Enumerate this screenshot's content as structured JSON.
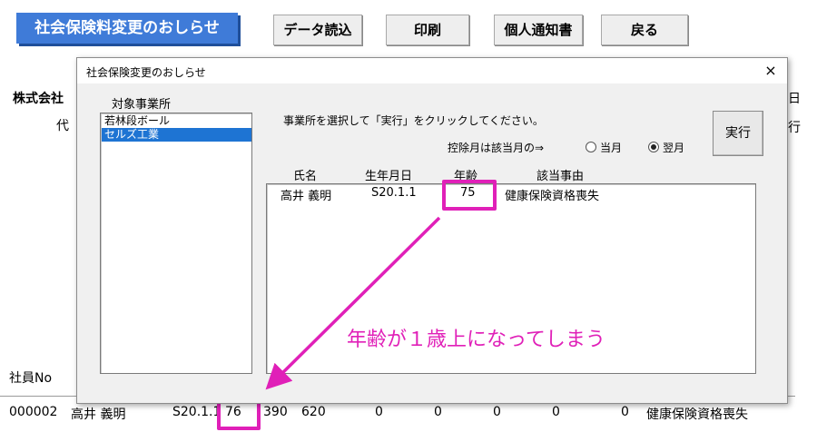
{
  "toolbar": {
    "title_button": "社会保険料変更のおしらせ",
    "import_button": "データ読込",
    "print_button": "印刷",
    "personal_notice_button": "個人通知書",
    "back_button": "戻る"
  },
  "sheet": {
    "company_prefix": "株式会社",
    "partial_char_left": "代",
    "partial_char_right_1": "日",
    "partial_char_right_2": "行",
    "employee_no_label": "社員No",
    "row": {
      "employee_no": "000002",
      "name": "高井 義明",
      "birthdate": "S20.1.1",
      "age": "76",
      "val1": "390",
      "val2": "620",
      "zero1": "0",
      "zero2": "0",
      "zero3": "0",
      "zero4": "0",
      "zero5": "0",
      "reason": "健康保険資格喪失"
    }
  },
  "dialog": {
    "title": "社会保険変更のおしらせ",
    "close_glyph": "×",
    "office_list_label": "対象事業所",
    "offices": [
      "若林段ボール",
      "セルズ工業"
    ],
    "selected_office_index": 1,
    "instruction": "事業所を選択して「実行」をクリックしてください。",
    "deduction_label": "控除月は該当月の⇒",
    "radio_current": "当月",
    "radio_next": "翌月",
    "selected_radio": "翌月",
    "execute_button": "実行",
    "results": {
      "headers": {
        "name": "氏名",
        "birthdate": "生年月日",
        "age": "年齢",
        "reason": "該当事由"
      },
      "rows": [
        {
          "name": "高井 義明",
          "birthdate": "S20.1.1",
          "age": "75",
          "reason": "健康保険資格喪失"
        }
      ]
    }
  },
  "annotation": {
    "text": "年齢が１歳上になってしまう",
    "color": "#e020b8"
  },
  "colors": {
    "title_button_bg": "#3f7bd8",
    "selection": "#1e74d3",
    "highlight": "#e020b8"
  }
}
